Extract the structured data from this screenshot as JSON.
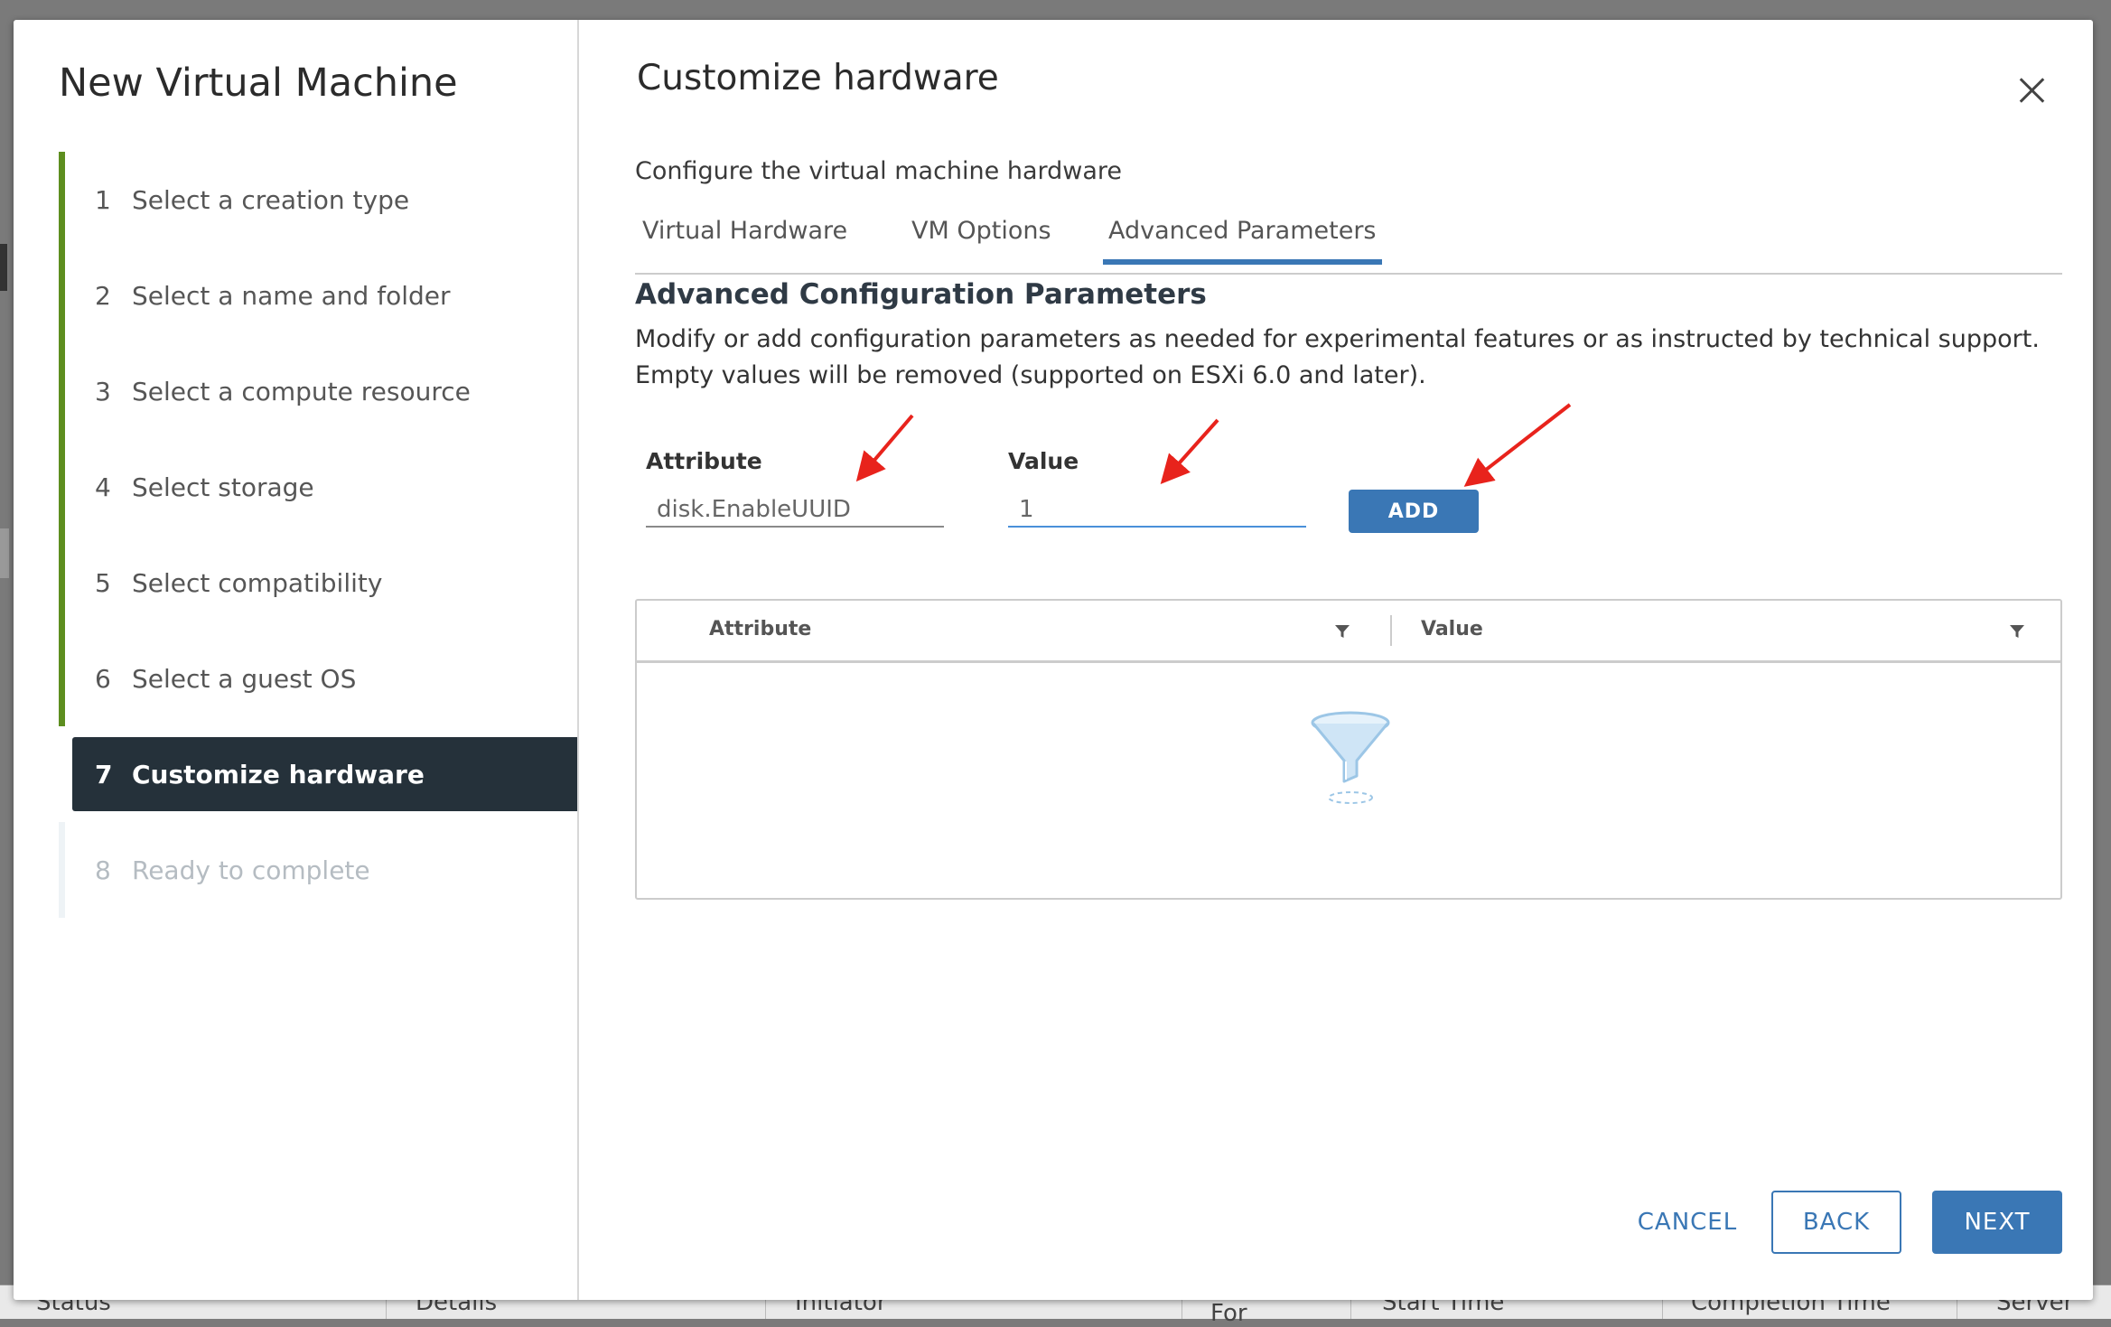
{
  "background": {
    "columns": [
      "Status",
      "Details",
      "Initiator",
      "For",
      "Start Time",
      "Completion Time",
      "Server"
    ]
  },
  "wizard": {
    "title": "New Virtual Machine",
    "steps": [
      {
        "num": "1",
        "label": "Select a creation type",
        "state": "done"
      },
      {
        "num": "2",
        "label": "Select a name and folder",
        "state": "done"
      },
      {
        "num": "3",
        "label": "Select a compute resource",
        "state": "done"
      },
      {
        "num": "4",
        "label": "Select storage",
        "state": "done"
      },
      {
        "num": "5",
        "label": "Select compatibility",
        "state": "done"
      },
      {
        "num": "6",
        "label": "Select a guest OS",
        "state": "done"
      },
      {
        "num": "7",
        "label": "Customize hardware",
        "state": "active"
      },
      {
        "num": "8",
        "label": "Ready to complete",
        "state": "future"
      }
    ]
  },
  "page": {
    "title": "Customize hardware",
    "subtitle": "Configure the virtual machine hardware",
    "tabs": [
      {
        "label": "Virtual Hardware",
        "selected": false
      },
      {
        "label": "VM Options",
        "selected": false
      },
      {
        "label": "Advanced Parameters",
        "selected": true
      }
    ],
    "section_title": "Advanced Configuration Parameters",
    "section_desc_1": "Modify or add configuration parameters as needed for experimental features or as instructed by technical support.",
    "section_desc_2": "Empty values will be removed (supported on ESXi 6.0 and later).",
    "attribute_label": "Attribute",
    "attribute_value": "disk.EnableUUID",
    "value_label": "Value",
    "value_value": "1",
    "add_label": "ADD",
    "grid": {
      "columns": [
        "Attribute",
        "Value"
      ],
      "rows": []
    }
  },
  "footer": {
    "cancel": "CANCEL",
    "back": "BACK",
    "next": "NEXT"
  },
  "colors": {
    "accent": "#3a77b5",
    "completed_bar": "#5d8e1f",
    "active_step_bg": "#25313a",
    "annotation_arrow": "#e8231c"
  },
  "icons": [
    "close-icon",
    "filter-icon",
    "empty-funnel-icon",
    "annotation-arrow"
  ]
}
